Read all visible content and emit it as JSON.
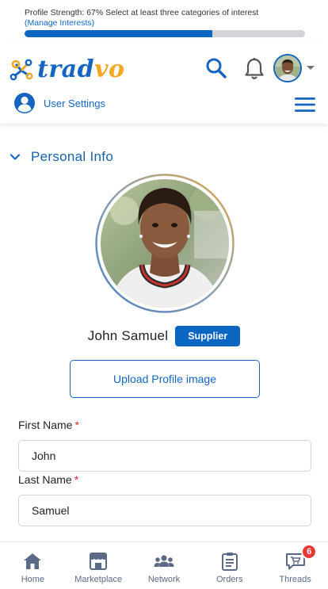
{
  "profile_strength": {
    "text": "Profile Strength: 67% Select at least three categories of interest",
    "manage_link": "(Manage Interests)",
    "progress_percent": 67,
    "fill_color": "#0a66c2"
  },
  "header": {
    "logo": {
      "part1": "trad",
      "part2": "vo"
    },
    "icons": {
      "search": "search-icon",
      "notifications": "bell-icon",
      "avatar_caret": "caret-down-icon",
      "menu": "hamburger-menu-icon"
    },
    "user_settings_label": "User Settings"
  },
  "section": {
    "title": "Personal Info"
  },
  "profile": {
    "name": "John Samuel",
    "role_badge": "Supplier",
    "upload_label": "Upload Profile image"
  },
  "form": {
    "first_name": {
      "label": "First Name",
      "required_mark": "*",
      "value": "John"
    },
    "last_name": {
      "label": "Last Name",
      "required_mark": "*",
      "value": "Samuel"
    }
  },
  "bottom_nav": {
    "items": [
      {
        "label": "Home",
        "icon": "home-icon"
      },
      {
        "label": "Marketplace",
        "icon": "storefront-icon"
      },
      {
        "label": "Network",
        "icon": "people-icon"
      },
      {
        "label": "Orders",
        "icon": "clipboard-icon"
      },
      {
        "label": "Threads",
        "icon": "chat-cart-icon",
        "badge": "6"
      }
    ]
  },
  "colors": {
    "primary": "#1565c0",
    "accent": "#f5a623",
    "badge_red": "#e53935"
  }
}
